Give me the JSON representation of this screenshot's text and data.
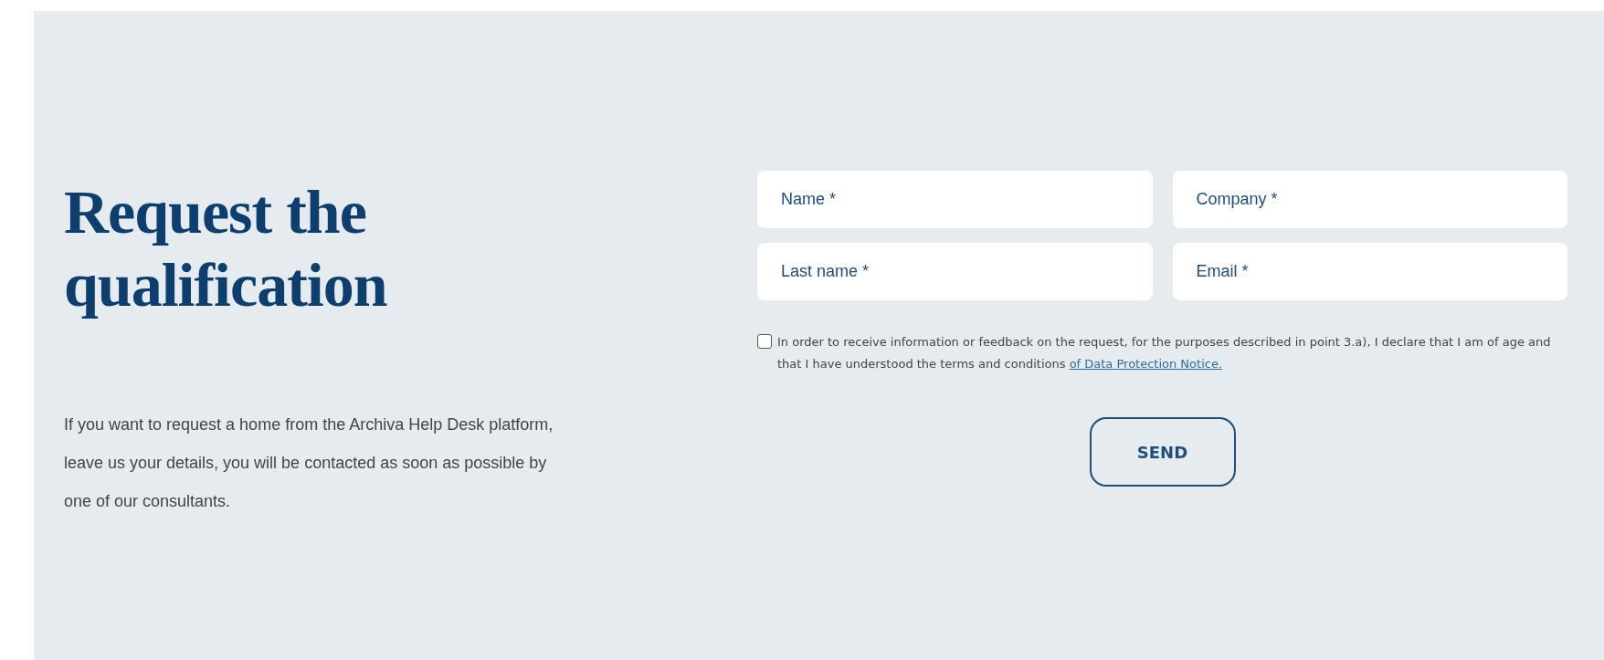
{
  "heading": "Request the qualification",
  "intro": "If you want to request a home from the Archiva Help Desk platform, leave us your details, you will be contacted as soon as possible by one of our consultants.",
  "fields": [
    {
      "placeholder": "Name *"
    },
    {
      "placeholder": "Company *"
    },
    {
      "placeholder": "Last name *"
    },
    {
      "placeholder": "Email *"
    }
  ],
  "consent": {
    "checked": false,
    "text": "In order to receive information or feedback on the request, for the purposes described in point 3.a), I declare that I am of age and that I have understood the terms and conditions",
    "link": "of Data Protection Notice."
  },
  "submit": "SEND"
}
